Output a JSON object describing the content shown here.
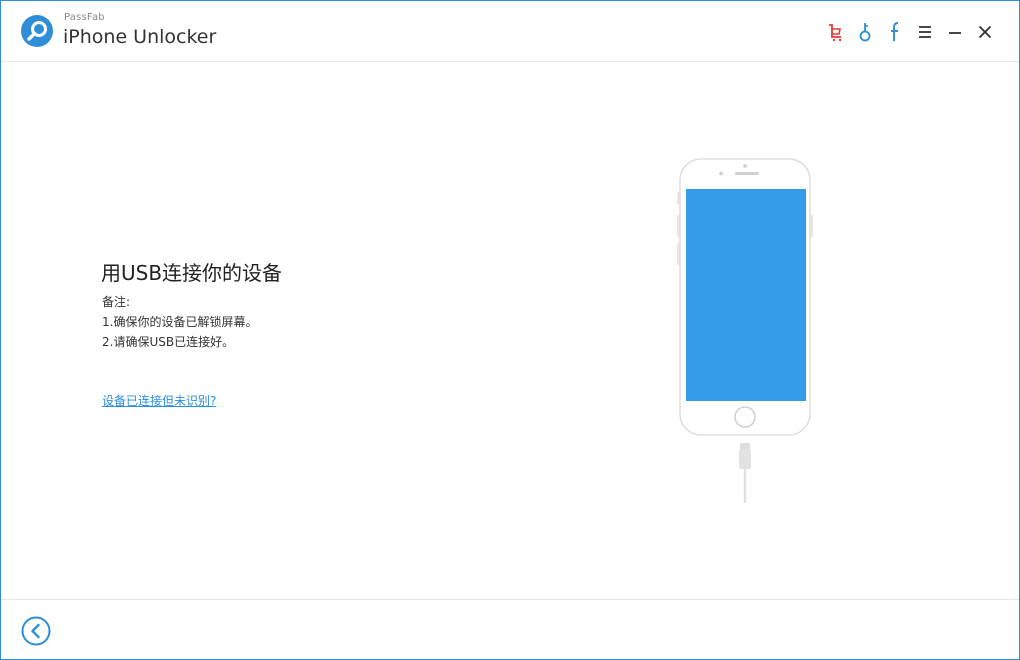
{
  "header": {
    "brand_small": "PassFab",
    "app_title": "iPhone Unlocker",
    "controls": [
      "cart-icon",
      "key-icon",
      "facebook-icon",
      "menu-icon",
      "minimize-icon",
      "close-icon"
    ]
  },
  "main": {
    "heading": "用USB连接你的设备",
    "notes_title": "备注:",
    "notes": [
      "1.确保你的设备已解锁屏幕。",
      "2.请确保USB已连接好。"
    ],
    "help_link": "设备已连接但未识别?"
  },
  "footer": {
    "back_icon": "back-arrow-icon"
  },
  "colors": {
    "accent": "#2e8fd8",
    "screen": "#359ceb",
    "cart": "#e53935",
    "link": "#2b8ee3"
  }
}
